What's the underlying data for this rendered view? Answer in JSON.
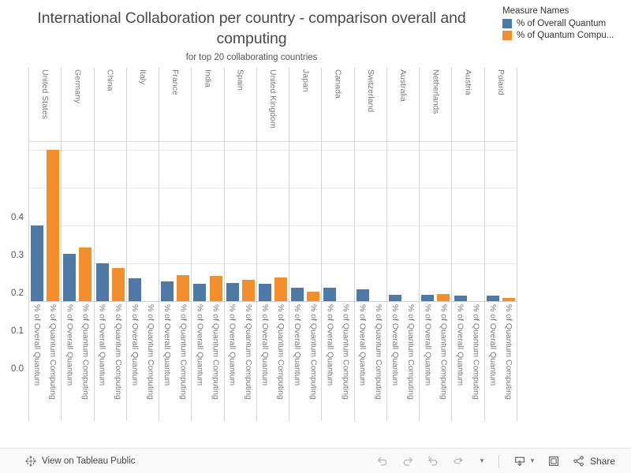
{
  "title": {
    "main": "International Collaboration per country - comparison overall and computing",
    "subtitle": "for top 20 collaborating countries"
  },
  "legend": {
    "title": "Measure Names",
    "items": [
      {
        "label": "% of Overall Quantum",
        "color": "#4e79a7",
        "swatch_name": "legend-swatch-overall-quantum"
      },
      {
        "label": "% of Quantum Compu...",
        "color": "#f28e2b",
        "swatch_name": "legend-swatch-quantum-computing"
      }
    ]
  },
  "toolbar": {
    "view_link": "View on Tableau Public",
    "share_label": "Share",
    "undo_label": "Undo",
    "redo_label": "Redo",
    "reset_label": "Reset",
    "refresh_label": "Refresh",
    "download_label": "Download",
    "fullscreen_label": "Full Screen"
  },
  "chart_data": {
    "type": "bar",
    "title": "International Collaboration per country - comparison overall and computing",
    "subtitle": "for top 20 collaborating countries",
    "xlabel": "",
    "ylabel": "",
    "ylim": [
      0.0,
      0.42
    ],
    "grid": true,
    "legend_position": "top-right",
    "yticks": [
      "0.0",
      "0.1",
      "0.2",
      "0.3",
      "0.4"
    ],
    "ytick_values": [
      0.0,
      0.1,
      0.2,
      0.3,
      0.4
    ],
    "categories": [
      "United States",
      "Germany",
      "China",
      "Italy",
      "France",
      "India",
      "Spain",
      "United Kingdom",
      "Japan",
      "Canada",
      "Switzerland",
      "Australia",
      "Netherlands",
      "Austria",
      "Poland"
    ],
    "measure_labels": [
      "% of Overall Quantum",
      "% of Quantum Computing"
    ],
    "series": [
      {
        "name": "% of Overall Quantum",
        "color": "#4e79a7",
        "values": [
          0.2,
          0.125,
          0.1,
          0.06,
          0.053,
          0.046,
          0.047,
          0.046,
          0.035,
          0.035,
          0.031,
          0.016,
          0.016,
          0.014,
          0.014
        ]
      },
      {
        "name": "% of Quantum Computing",
        "color": "#f28e2b",
        "values": [
          0.4,
          0.141,
          0.087,
          0.0,
          0.068,
          0.067,
          0.057,
          0.063,
          0.026,
          0.0,
          0.0,
          0.0,
          0.018,
          0.0,
          0.008
        ]
      }
    ]
  }
}
